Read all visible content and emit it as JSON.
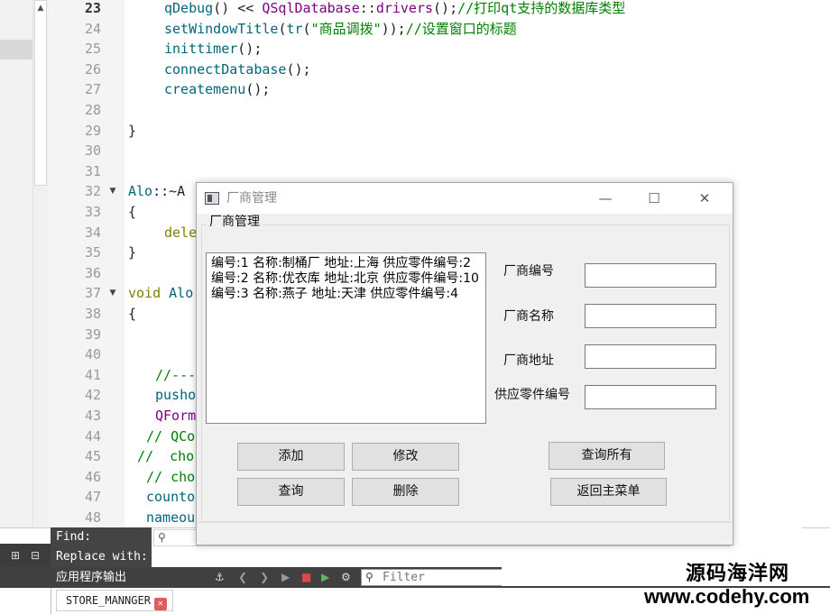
{
  "editor": {
    "lines": [
      {
        "no": "23",
        "current": true,
        "fold": "",
        "code": [
          {
            "t": "qDebug",
            "c": "fn"
          },
          {
            "t": "() << ",
            "c": ""
          },
          {
            "t": "QSqlDatabase",
            "c": "dr"
          },
          {
            "t": "::",
            "c": ""
          },
          {
            "t": "drivers",
            "c": "dr"
          },
          {
            "t": "();",
            "c": ""
          },
          {
            "t": "//打印qt支持的数据库类型",
            "c": "cm"
          }
        ],
        "indent": 40
      },
      {
        "no": "24",
        "fold": "",
        "code": [
          {
            "t": "setWindowTitle",
            "c": "fn"
          },
          {
            "t": "(",
            "c": ""
          },
          {
            "t": "tr",
            "c": "fn"
          },
          {
            "t": "(",
            "c": ""
          },
          {
            "t": "\"商品调拨\"",
            "c": "st"
          },
          {
            "t": "));",
            "c": ""
          },
          {
            "t": "//设置窗口的标题",
            "c": "cm"
          }
        ],
        "indent": 40
      },
      {
        "no": "25",
        "fold": "",
        "code": [
          {
            "t": "inittimer",
            "c": "fn"
          },
          {
            "t": "();",
            "c": ""
          }
        ],
        "indent": 40
      },
      {
        "no": "26",
        "fold": "",
        "code": [
          {
            "t": "connectDatabase",
            "c": "fn"
          },
          {
            "t": "();",
            "c": ""
          }
        ],
        "indent": 40
      },
      {
        "no": "27",
        "fold": "",
        "code": [
          {
            "t": "createmenu",
            "c": "fn"
          },
          {
            "t": "();",
            "c": ""
          }
        ],
        "indent": 40
      },
      {
        "no": "28",
        "fold": "",
        "code": [],
        "indent": 0
      },
      {
        "no": "29",
        "fold": "",
        "code": [
          {
            "t": "}",
            "c": ""
          }
        ],
        "indent": 0
      },
      {
        "no": "30",
        "fold": "",
        "code": [],
        "indent": 0
      },
      {
        "no": "31",
        "fold": "",
        "code": [],
        "indent": 0
      },
      {
        "no": "32",
        "fold": "▼",
        "code": [
          {
            "t": "Alo",
            "c": "fn"
          },
          {
            "t": "::~A",
            "c": ""
          }
        ],
        "indent": 0
      },
      {
        "no": "33",
        "fold": "",
        "code": [
          {
            "t": "{",
            "c": ""
          }
        ],
        "indent": 0
      },
      {
        "no": "34",
        "fold": "",
        "code": [
          {
            "t": "dele",
            "c": "kw"
          }
        ],
        "indent": 40
      },
      {
        "no": "35",
        "fold": "",
        "code": [
          {
            "t": "}",
            "c": ""
          }
        ],
        "indent": 0
      },
      {
        "no": "36",
        "fold": "",
        "code": [],
        "indent": 0
      },
      {
        "no": "37",
        "fold": "▼",
        "code": [
          {
            "t": "void ",
            "c": "kw"
          },
          {
            "t": "Alo",
            "c": "fn"
          }
        ],
        "indent": 0
      },
      {
        "no": "38",
        "fold": "",
        "code": [
          {
            "t": "{",
            "c": ""
          }
        ],
        "indent": 0
      },
      {
        "no": "39",
        "fold": "",
        "code": [],
        "indent": 0
      },
      {
        "no": "40",
        "fold": "",
        "code": [],
        "indent": 0
      },
      {
        "no": "41",
        "fold": "",
        "code": [
          {
            "t": "//---",
            "c": "cm"
          }
        ],
        "indent": 30
      },
      {
        "no": "42",
        "fold": "",
        "code": [
          {
            "t": "pusho",
            "c": "fn"
          }
        ],
        "indent": 30
      },
      {
        "no": "43",
        "fold": "",
        "code": [
          {
            "t": "QForm",
            "c": "dr"
          }
        ],
        "indent": 30
      },
      {
        "no": "44",
        "fold": "",
        "code": [
          {
            "t": "// QCo",
            "c": "cm"
          }
        ],
        "indent": 20
      },
      {
        "no": "45",
        "fold": "",
        "code": [
          {
            "t": "//  cho",
            "c": "cm"
          }
        ],
        "indent": 10
      },
      {
        "no": "46",
        "fold": "",
        "code": [
          {
            "t": "// cho",
            "c": "cm"
          }
        ],
        "indent": 20
      },
      {
        "no": "47",
        "fold": "",
        "code": [
          {
            "t": "counto",
            "c": "fn"
          }
        ],
        "indent": 20
      },
      {
        "no": "48",
        "fold": "",
        "code": [
          {
            "t": "nameou",
            "c": "fn"
          }
        ],
        "indent": 20
      }
    ]
  },
  "find": {
    "find_label": "Find:",
    "replace_label": "Replace with:"
  },
  "output": {
    "title": "应用程序输出",
    "filter_placeholder": "Filter",
    "tab_label": "STORE_MANNGER"
  },
  "watermark": {
    "name": "源码海洋网",
    "url": "www.codehy.com"
  },
  "dialog": {
    "title": "厂商管理",
    "group_title": "厂商管理",
    "list": [
      "编号:1    名称:制桶厂   地址:上海   供应零件编号:2",
      "编号:2    名称:优衣库   地址:北京   供应零件编号:10",
      "编号:3    名称:燕子   地址:天津   供应零件编号:4"
    ],
    "fields": {
      "vendor_id": {
        "label": "厂商编号",
        "value": ""
      },
      "vendor_name": {
        "label": "厂商名称",
        "value": ""
      },
      "vendor_address": {
        "label": "厂商地址",
        "value": ""
      },
      "part_id": {
        "label": "供应零件编号",
        "value": ""
      }
    },
    "buttons": {
      "add": "添加",
      "modify": "修改",
      "query": "查询",
      "delete": "删除",
      "query_all": "查询所有",
      "back": "返回主菜单"
    }
  }
}
